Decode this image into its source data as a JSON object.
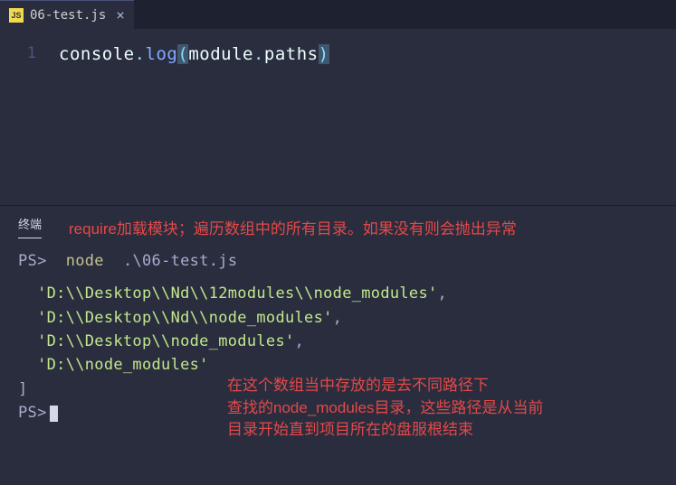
{
  "tab": {
    "icon_label": "JS",
    "filename": "06-test.js",
    "close": "×"
  },
  "editor": {
    "line_number": "1",
    "tokens": {
      "console": "console",
      "dot1": ".",
      "log": "log",
      "lparen": "(",
      "module": "module",
      "dot2": ".",
      "paths": "paths",
      "rparen": ")"
    }
  },
  "terminal": {
    "tab_label": "终端",
    "annotation_top": "require加载模块；遍历数组中的所有目录。如果没有则会抛出异常",
    "prompt": "PS>",
    "cmd_node": "node",
    "cmd_arg": ".\\06-test.js",
    "output": {
      "line1": "'D:\\\\Desktop\\\\Nd\\\\12modules\\\\node_modules'",
      "comma": ",",
      "line2": "'D:\\\\Desktop\\\\Nd\\\\node_modules'",
      "line3": "'D:\\\\Desktop\\\\node_modules'",
      "line4": "'D:\\\\node_modules'",
      "bracket": "]"
    },
    "annotation_bottom_l1": "在这个数组当中存放的是去不同路径下",
    "annotation_bottom_l2": "查找的node_modules目录，这些路径是从当前",
    "annotation_bottom_l3": "目录开始直到项目所在的盘服根结束"
  }
}
